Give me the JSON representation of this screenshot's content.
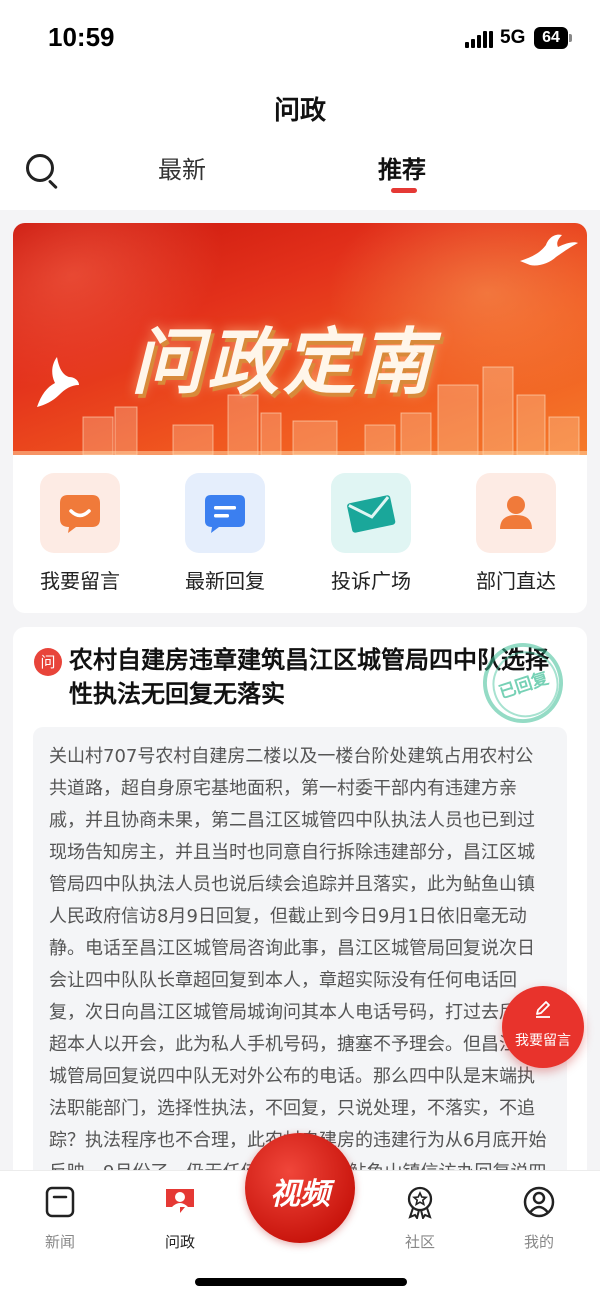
{
  "status_bar": {
    "time": "10:59",
    "network": "5G",
    "battery": "64"
  },
  "header": {
    "title": "问政",
    "tabs": [
      {
        "label": "最新",
        "active": false
      },
      {
        "label": "推荐",
        "active": true
      }
    ],
    "search_icon": "search-icon"
  },
  "banner": {
    "title": "问政定南"
  },
  "entries": [
    {
      "label": "我要留言",
      "icon": "message-smile-icon",
      "color": "#f07a3a"
    },
    {
      "label": "最新回复",
      "icon": "chat-bubble-icon",
      "color": "#3b7ff0"
    },
    {
      "label": "投诉广场",
      "icon": "envelope-icon",
      "color": "#1aa79a"
    },
    {
      "label": "部门直达",
      "icon": "person-icon",
      "color": "#f07a3a"
    }
  ],
  "post": {
    "badge": "问",
    "title": "农村自建房违章建筑昌江区城管局四中队选择性执法无回复无落实",
    "stamp": "已回复",
    "body": "关山村707号农村自建房二楼以及一楼台阶处建筑占用农村公共道路，超自身原宅基地面积，第一村委干部内有违建方亲戚，并且协商未果，第二昌江区城管四中队执法人员也已到过现场告知房主，并且当时也同意自行拆除违建部分，昌江区城管局四中队执法人员也说后续会追踪并且落实，此为鲇鱼山镇人民政府信访8月9日回复，但截止到今日9月1日依旧毫无动静。电话至昌江区城管局咨询此事，昌江区城管局回复说次日会让四中队队长章超回复到本人，章超实际没有任何电话回复，次日向昌江区城管局城询问其本人电话号码，打过去后章超本人以开会，此为私人手机号码，搪塞不予理会。但昌江区城管局回复说四中队无对外公布的电话。那么四中队是末端执法职能部门，选择性执法，不回复，只说处理，不落实，不追踪？执法程序也不合理，此农村自建房的违建行为从6月底开始反映，9月份了，仍无任何处理，只有鲇鱼山镇信访办回复说四中队开具了整改通知，也拆了，但是不给予图"
  },
  "fab": {
    "label": "我要留言",
    "icon": "edit-icon"
  },
  "tab_bar": {
    "items": [
      {
        "label": "新闻",
        "icon": "news-icon",
        "active": false
      },
      {
        "label": "问政",
        "icon": "wenzheng-icon",
        "active": true
      },
      {
        "label": "社区",
        "icon": "community-badge-icon",
        "active": false
      },
      {
        "label": "我的",
        "icon": "profile-icon",
        "active": false
      }
    ],
    "video_label": "视频"
  },
  "colors": {
    "accent": "#e53935",
    "banner_red": "#d9251a",
    "stamp_green": "#3cbe96"
  }
}
